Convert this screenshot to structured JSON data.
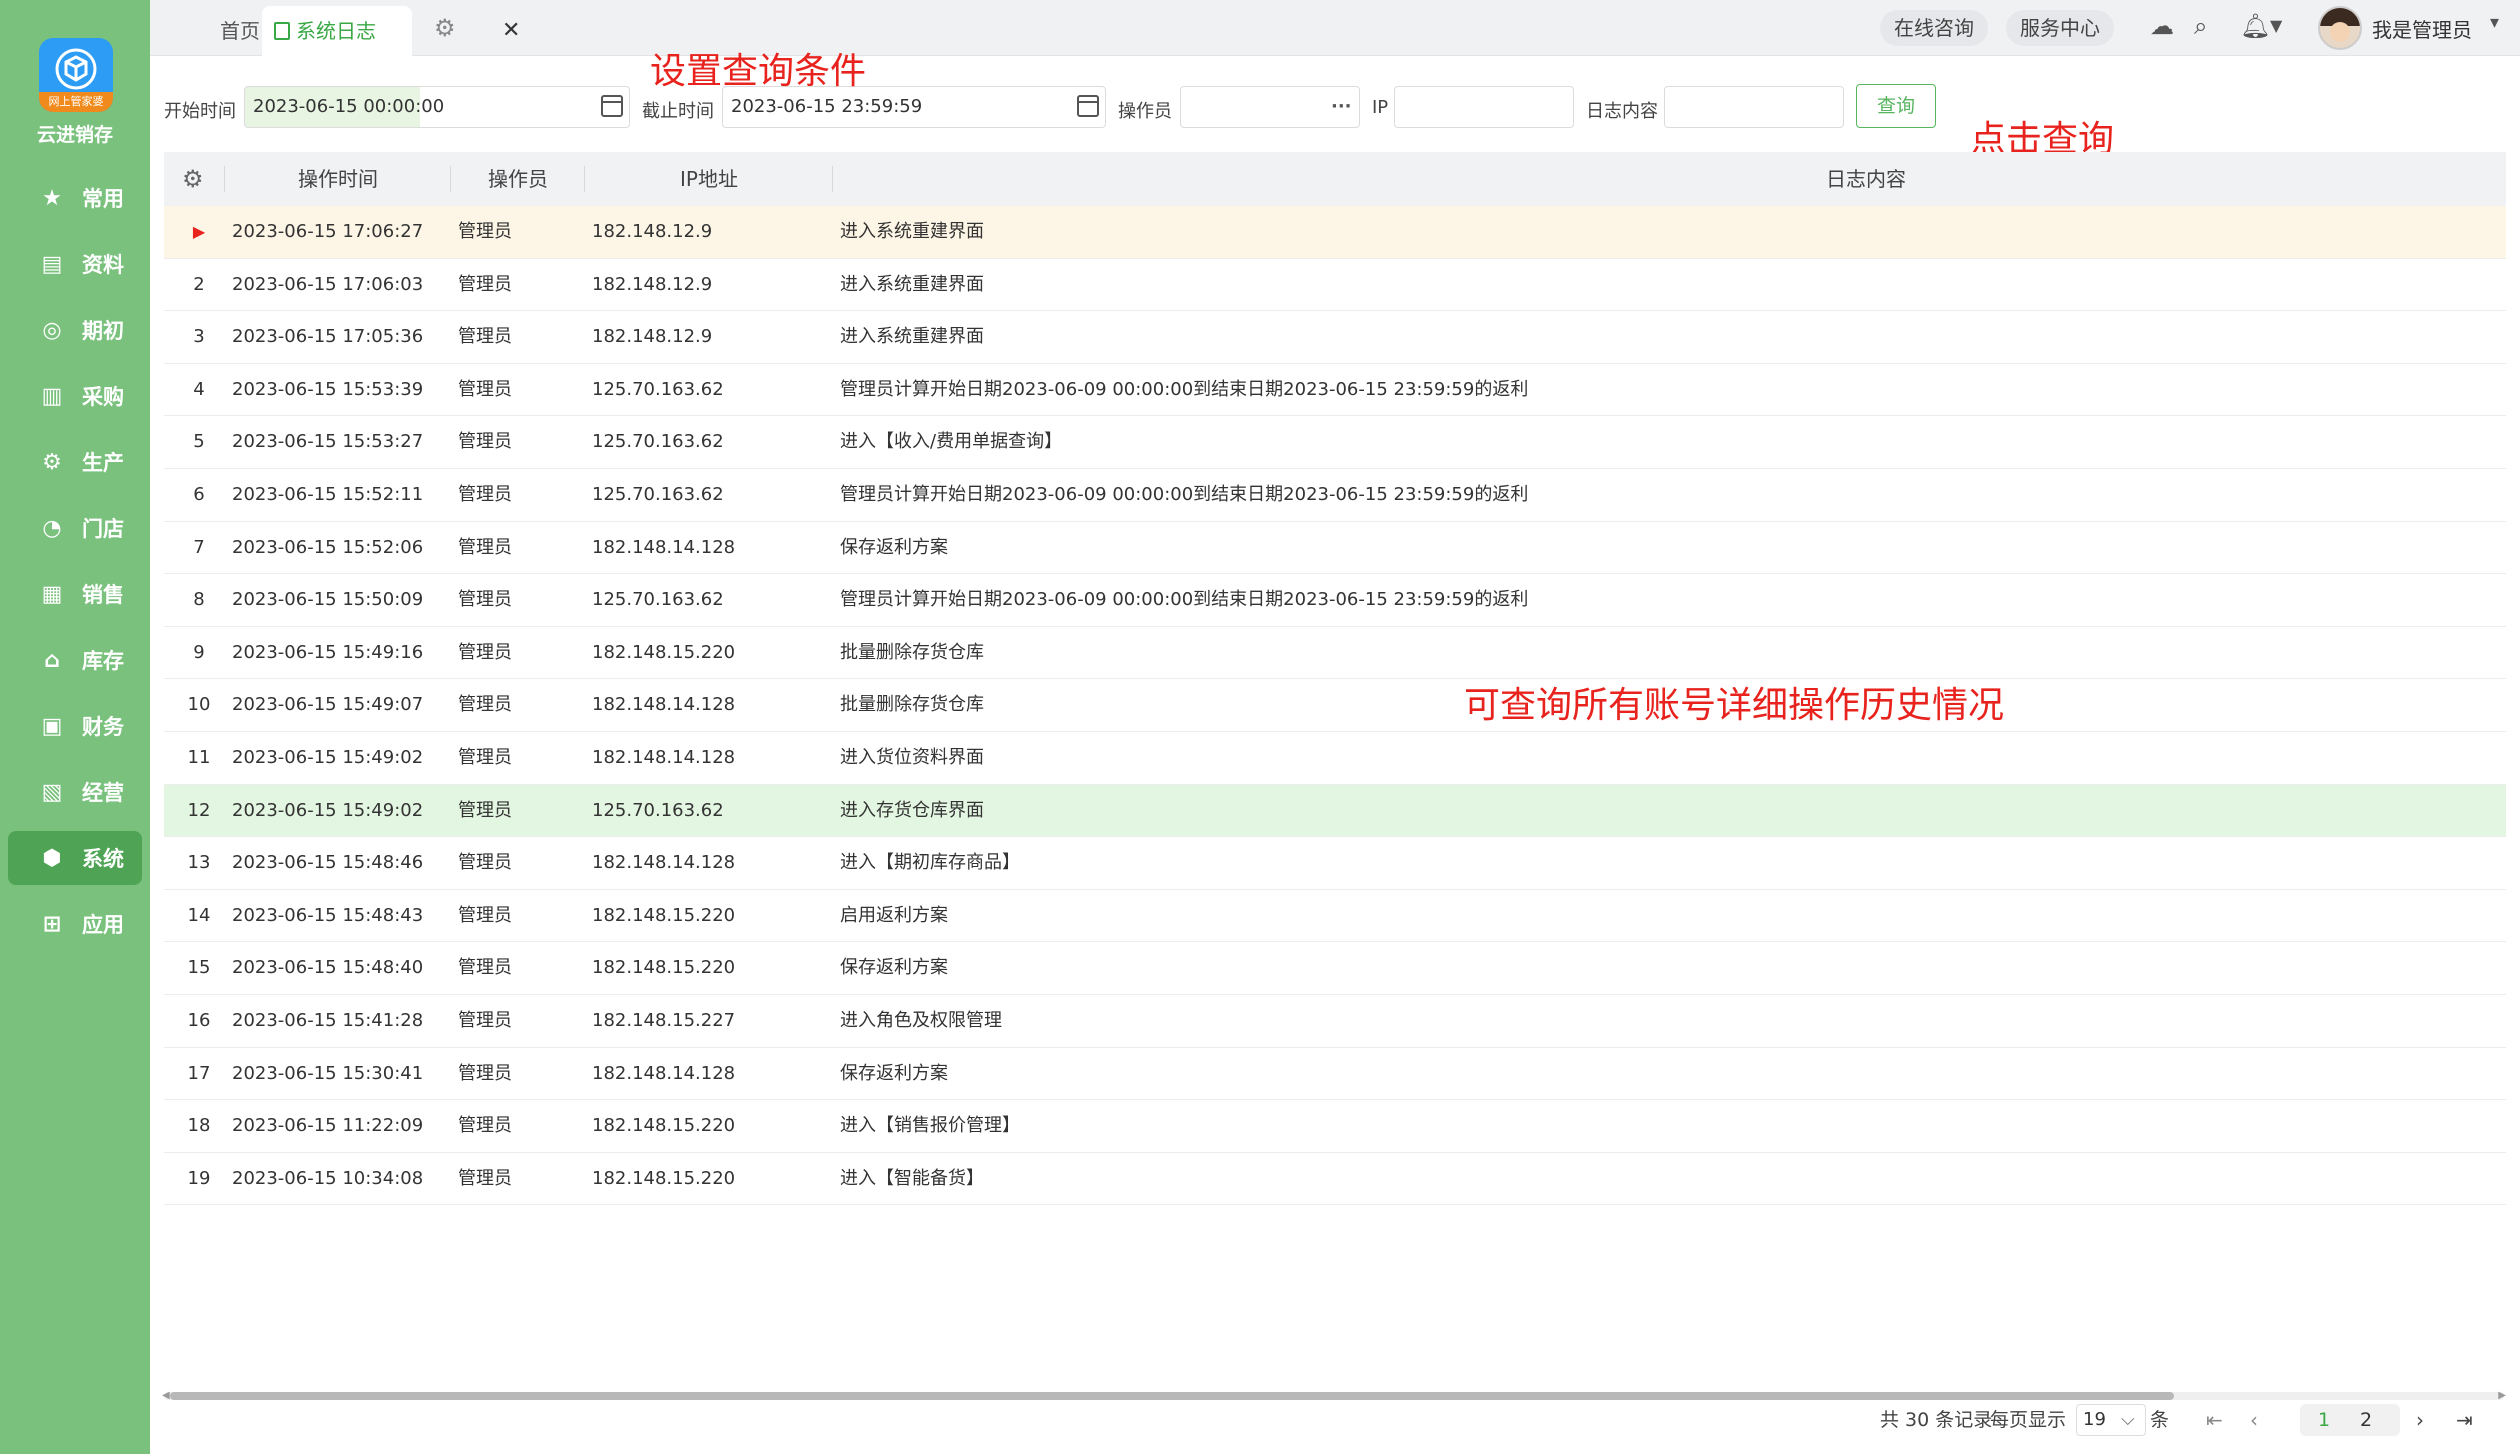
{
  "app": {
    "brand": "云进销存",
    "logo_ribbon": "网上管家婆"
  },
  "sidebar": {
    "items": [
      {
        "label": "常用",
        "icon": "star-icon",
        "glyph": "★"
      },
      {
        "label": "资料",
        "icon": "document-icon",
        "glyph": "▤"
      },
      {
        "label": "期初",
        "icon": "target-icon",
        "glyph": "◎"
      },
      {
        "label": "采购",
        "icon": "purchase-icon",
        "glyph": "▥"
      },
      {
        "label": "生产",
        "icon": "production-icon",
        "glyph": "⚙"
      },
      {
        "label": "门店",
        "icon": "pie-icon",
        "glyph": "◔"
      },
      {
        "label": "销售",
        "icon": "bar-chart-icon",
        "glyph": "▦"
      },
      {
        "label": "库存",
        "icon": "warehouse-icon",
        "glyph": "⌂"
      },
      {
        "label": "财务",
        "icon": "wallet-icon",
        "glyph": "▣"
      },
      {
        "label": "经营",
        "icon": "image-icon",
        "glyph": "▧"
      },
      {
        "label": "系统",
        "icon": "system-icon",
        "glyph": "⬢"
      },
      {
        "label": "应用",
        "icon": "plus-icon",
        "glyph": "⊞"
      }
    ],
    "active": "系统"
  },
  "tabs": {
    "home": "首页",
    "current": "系统日志"
  },
  "topbar": {
    "consult": "在线咨询",
    "service": "服务中心",
    "user": "我是管理员"
  },
  "filter": {
    "start_label": "开始时间",
    "start_value": "2023-06-15 00:00:00",
    "end_label": "截止时间",
    "end_value": "2023-06-15 23:59:59",
    "operator_label": "操作员",
    "operator_value": "",
    "ip_label": "IP",
    "ip_value": "",
    "content_label": "日志内容",
    "content_value": "",
    "query_button": "查询",
    "more_glyph": "···"
  },
  "annotations": {
    "set_conditions": "设置查询条件",
    "click_query": "点击查询",
    "history_note": "可查询所有账号详细操作历史情况"
  },
  "table": {
    "headers": {
      "time": "操作时间",
      "operator": "操作员",
      "ip": "IP地址",
      "content": "日志内容"
    },
    "rows": [
      {
        "no": "",
        "time": "2023-06-15 17:06:27",
        "operator": "管理员",
        "ip": "182.148.12.9",
        "content": "进入系统重建界面"
      },
      {
        "no": "2",
        "time": "2023-06-15 17:06:03",
        "operator": "管理员",
        "ip": "182.148.12.9",
        "content": "进入系统重建界面"
      },
      {
        "no": "3",
        "time": "2023-06-15 17:05:36",
        "operator": "管理员",
        "ip": "182.148.12.9",
        "content": "进入系统重建界面"
      },
      {
        "no": "4",
        "time": "2023-06-15 15:53:39",
        "operator": "管理员",
        "ip": "125.70.163.62",
        "content": "管理员计算开始日期2023-06-09 00:00:00到结束日期2023-06-15 23:59:59的返利"
      },
      {
        "no": "5",
        "time": "2023-06-15 15:53:27",
        "operator": "管理员",
        "ip": "125.70.163.62",
        "content": "进入【收入/费用单据查询】"
      },
      {
        "no": "6",
        "time": "2023-06-15 15:52:11",
        "operator": "管理员",
        "ip": "125.70.163.62",
        "content": "管理员计算开始日期2023-06-09 00:00:00到结束日期2023-06-15 23:59:59的返利"
      },
      {
        "no": "7",
        "time": "2023-06-15 15:52:06",
        "operator": "管理员",
        "ip": "182.148.14.128",
        "content": "保存返利方案"
      },
      {
        "no": "8",
        "time": "2023-06-15 15:50:09",
        "operator": "管理员",
        "ip": "125.70.163.62",
        "content": "管理员计算开始日期2023-06-09 00:00:00到结束日期2023-06-15 23:59:59的返利"
      },
      {
        "no": "9",
        "time": "2023-06-15 15:49:16",
        "operator": "管理员",
        "ip": "182.148.15.220",
        "content": "批量删除存货仓库"
      },
      {
        "no": "10",
        "time": "2023-06-15 15:49:07",
        "operator": "管理员",
        "ip": "182.148.14.128",
        "content": "批量删除存货仓库"
      },
      {
        "no": "11",
        "time": "2023-06-15 15:49:02",
        "operator": "管理员",
        "ip": "182.148.14.128",
        "content": "进入货位资料界面"
      },
      {
        "no": "12",
        "time": "2023-06-15 15:49:02",
        "operator": "管理员",
        "ip": "125.70.163.62",
        "content": "进入存货仓库界面"
      },
      {
        "no": "13",
        "time": "2023-06-15 15:48:46",
        "operator": "管理员",
        "ip": "182.148.14.128",
        "content": "进入【期初库存商品】"
      },
      {
        "no": "14",
        "time": "2023-06-15 15:48:43",
        "operator": "管理员",
        "ip": "182.148.15.220",
        "content": "启用返利方案"
      },
      {
        "no": "15",
        "time": "2023-06-15 15:48:40",
        "operator": "管理员",
        "ip": "182.148.15.220",
        "content": "保存返利方案"
      },
      {
        "no": "16",
        "time": "2023-06-15 15:41:28",
        "operator": "管理员",
        "ip": "182.148.15.227",
        "content": "进入角色及权限管理"
      },
      {
        "no": "17",
        "time": "2023-06-15 15:30:41",
        "operator": "管理员",
        "ip": "182.148.14.128",
        "content": "保存返利方案"
      },
      {
        "no": "18",
        "time": "2023-06-15 11:22:09",
        "operator": "管理员",
        "ip": "182.148.15.220",
        "content": "进入【销售报价管理】"
      },
      {
        "no": "19",
        "time": "2023-06-15 10:34:08",
        "operator": "管理员",
        "ip": "182.148.15.220",
        "content": "进入【智能备货】"
      }
    ]
  },
  "pager": {
    "total_text": "共 30 条记录",
    "per_page_label": "每页显示",
    "per_page_value": "19",
    "unit": "条",
    "pages": [
      "1",
      "2"
    ],
    "current_page": "1"
  },
  "colors": {
    "sidebar": "#7ac17e",
    "accent": "#3aa845",
    "annotation": "#e8231d"
  }
}
